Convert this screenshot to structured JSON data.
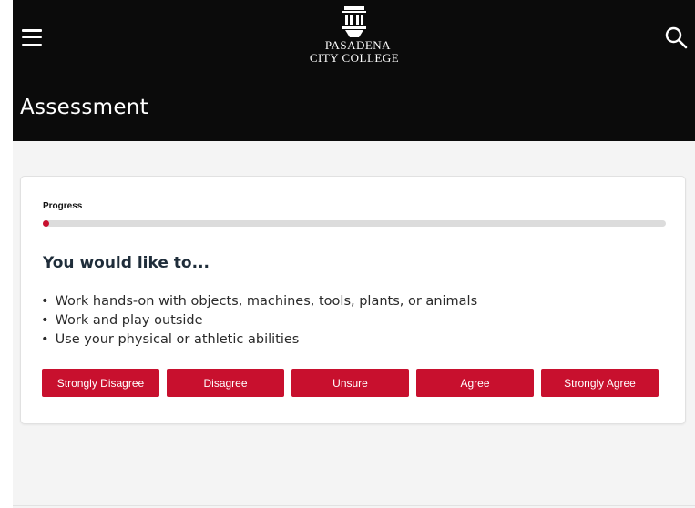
{
  "header": {
    "logo_line1": "Pasadena",
    "logo_line2": "City College",
    "page_title": "Assessment"
  },
  "assessment": {
    "progress_label": "Progress",
    "progress_value": 0.01,
    "question_title": "You would like to...",
    "bullets": [
      "Work hands-on with objects, machines, tools, plants, or animals",
      "Work and play outside",
      "Use your physical or athletic abilities"
    ],
    "answers": [
      "Strongly Disagree",
      "Disagree",
      "Unsure",
      "Agree",
      "Strongly Agree"
    ]
  },
  "colors": {
    "header_bg": "#0b0b0b",
    "accent": "#c8102e",
    "content_bg": "#f4f4f4",
    "progress_track": "#dcdcdc"
  },
  "icons": {
    "menu": "hamburger-icon",
    "search": "search-icon",
    "logo": "college-building-icon"
  }
}
